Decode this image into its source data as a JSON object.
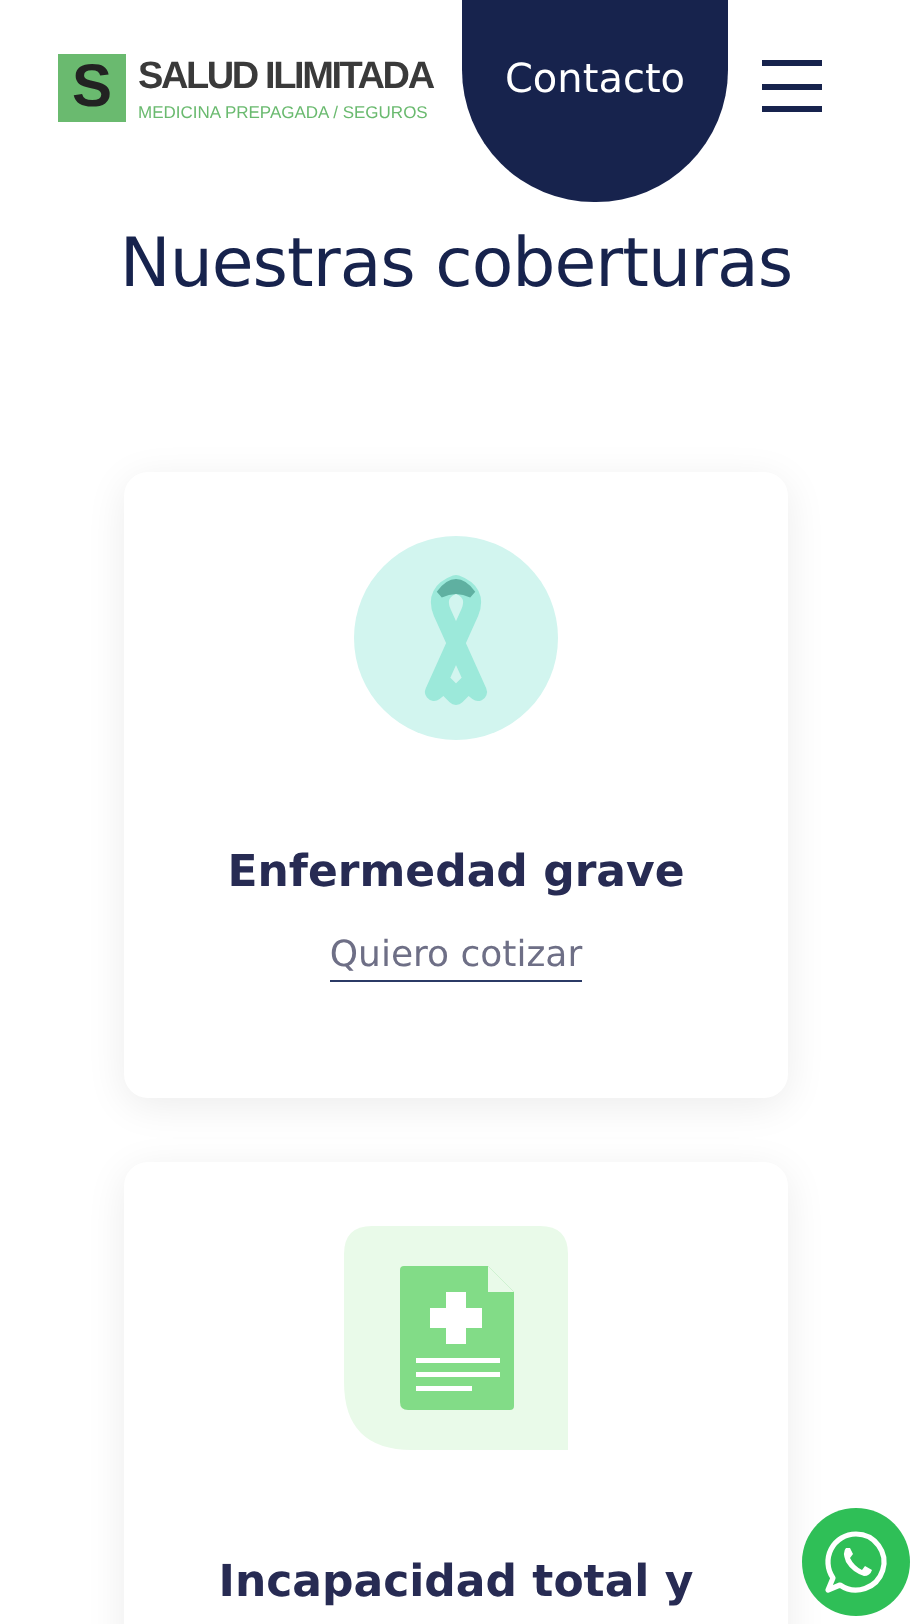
{
  "header": {
    "logo": {
      "letter": "S",
      "name": "SALUD ILIMITADA",
      "tagline": "MEDICINA PREPAGADA / SEGUROS"
    },
    "contact_button": "Contacto"
  },
  "title": "Nuestras coberturas",
  "cards": [
    {
      "kind": "ribbon",
      "title": "Enfermedad grave",
      "link": "Quiero cotizar"
    },
    {
      "kind": "document",
      "title": "Incapacidad total y"
    }
  ]
}
